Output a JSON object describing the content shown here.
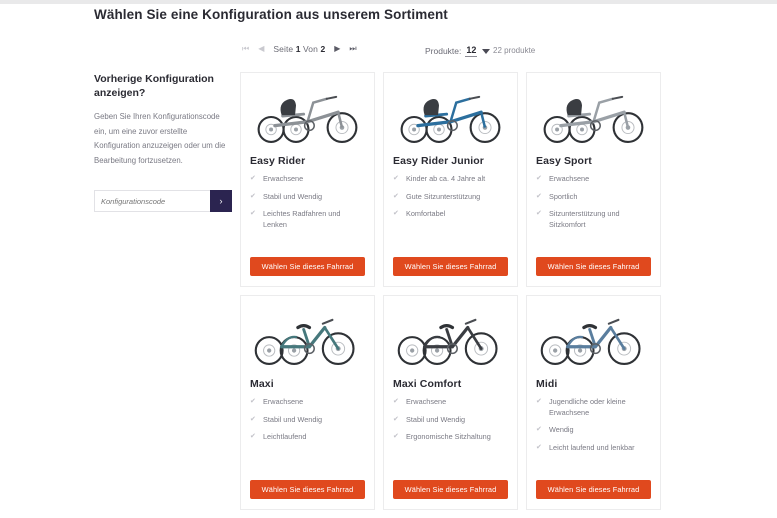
{
  "page": {
    "title": "Wählen Sie eine Konfiguration aus unserem Sortiment"
  },
  "toolbar": {
    "first_icon": "⏮",
    "prev_icon": "◀",
    "next_icon": "▶",
    "last_icon": "⏭",
    "page_prefix": "Seite",
    "page_current": "1",
    "page_middle": "Von",
    "page_total": "2",
    "perpage_label": "Produkte:",
    "perpage_value": "12",
    "total_label": "22 produkte"
  },
  "sidebar": {
    "heading": "Vorherige Konfiguration anzeigen?",
    "body": "Geben Sie Ihren Konfigurationscode ein, um eine zuvor erstellte Konfiguration anzuzeigen oder um die Bearbeitung fortzusetzen.",
    "input_placeholder": "Konfigurationscode",
    "submit_icon": "›"
  },
  "colors": {
    "accent_orange": "#e0491e",
    "navy": "#2b2450",
    "text_dark": "#2b2b33",
    "text_muted": "#7a7a84",
    "border": "#ececed"
  },
  "products": [
    {
      "name": "Easy Rider",
      "image": "bike-easy-rider",
      "frame_color": "#8c9196",
      "features": [
        "Erwachsene",
        "Stabil und Wendig",
        "Leichtes Radfahren und Lenken"
      ],
      "cta": "Wählen Sie dieses Fahrrad"
    },
    {
      "name": "Easy Rider Junior",
      "image": "bike-easy-rider-junior",
      "frame_color": "#2c6f9e",
      "features": [
        "Kinder ab ca. 4 Jahre alt",
        "Gute Sitzunterstützung",
        "Komfortabel"
      ],
      "cta": "Wählen Sie dieses Fahrrad"
    },
    {
      "name": "Easy Sport",
      "image": "bike-easy-sport",
      "frame_color": "#9aa0a6",
      "features": [
        "Erwachsene",
        "Sportlich",
        "Sitzunterstützung und Sitzkomfort"
      ],
      "cta": "Wählen Sie dieses Fahrrad"
    },
    {
      "name": "Maxi",
      "image": "bike-maxi",
      "frame_color": "#46787c",
      "features": [
        "Erwachsene",
        "Stabil und Wendig",
        "Leichtlaufend"
      ],
      "cta": "Wählen Sie dieses Fahrrad"
    },
    {
      "name": "Maxi Comfort",
      "image": "bike-maxi-comfort",
      "frame_color": "#3a3d42",
      "features": [
        "Erwachsene",
        "Stabil und Wendig",
        "Ergonomische Sitzhaltung"
      ],
      "cta": "Wählen Sie dieses Fahrrad"
    },
    {
      "name": "Midi",
      "image": "bike-midi",
      "frame_color": "#5a7e9e",
      "features": [
        "Jugendliche oder kleine Erwachsene",
        "Wendig",
        "Leicht laufend und lenkbar"
      ],
      "cta": "Wählen Sie dieses Fahrrad"
    }
  ],
  "tick_icon": "✔"
}
